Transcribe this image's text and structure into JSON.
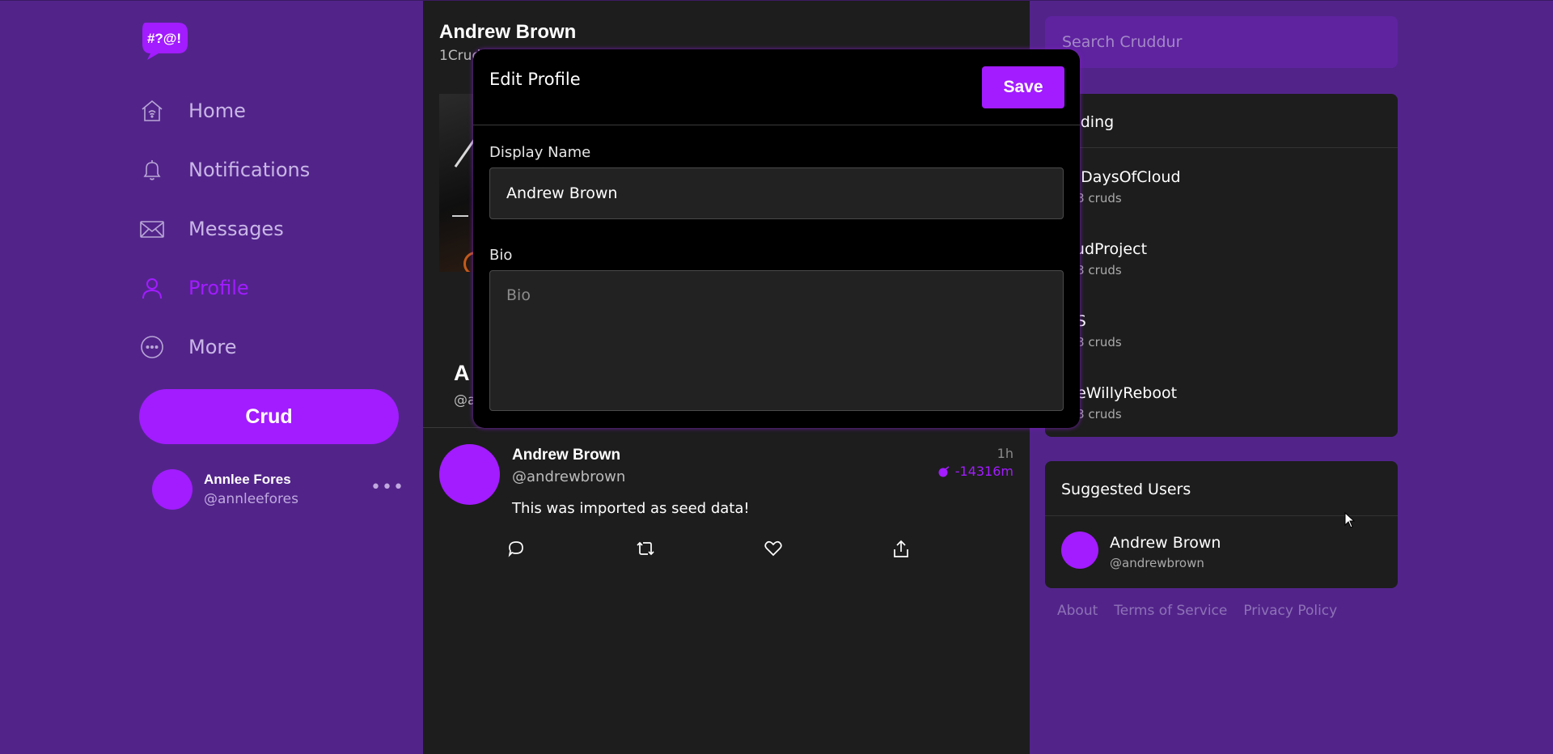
{
  "app": {
    "logo_text": "#?@!"
  },
  "sidebar": {
    "items": [
      {
        "label": "Home",
        "icon": "home-icon",
        "active": false
      },
      {
        "label": "Notifications",
        "icon": "bell-icon",
        "active": false
      },
      {
        "label": "Messages",
        "icon": "mail-icon",
        "active": false
      },
      {
        "label": "Profile",
        "icon": "person-icon",
        "active": true
      },
      {
        "label": "More",
        "icon": "more-circle-icon",
        "active": false
      }
    ],
    "crud_button_label": "Crud",
    "current_user": {
      "name": "Annlee Fores",
      "handle": "@annleefores",
      "menu_icon": "ellipsis-icon"
    }
  },
  "feed": {
    "title": "Andrew Brown",
    "subtitle": "1Crud",
    "profile_name_partial": "A",
    "profile_handle_partial": "@a",
    "posts": [
      {
        "name": "Andrew Brown",
        "handle": "@andrewbrown",
        "time": "1h",
        "expires": "-14316m",
        "text": "This was imported as seed data!",
        "actions": [
          "reply-icon",
          "repost-icon",
          "like-icon",
          "share-icon"
        ]
      }
    ]
  },
  "search": {
    "placeholder": "Search Cruddur",
    "value": ""
  },
  "trending": {
    "header": "ending",
    "items": [
      {
        "name": "00DaysOfCloud",
        "count": "053 cruds"
      },
      {
        "name": "loudProject",
        "count": "253 cruds"
      },
      {
        "name": "WS",
        "count": "053 cruds"
      },
      {
        "name": "reeWillyReboot",
        "count": "753 cruds"
      }
    ]
  },
  "suggested": {
    "header": "Suggested Users",
    "users": [
      {
        "name": "Andrew Brown",
        "handle": "@andrewbrown"
      }
    ]
  },
  "footer": {
    "links": [
      "About",
      "Terms of Service",
      "Privacy Policy"
    ]
  },
  "modal": {
    "title": "Edit Profile",
    "save_label": "Save",
    "display_name_label": "Display Name",
    "display_name_value": "Andrew Brown",
    "bio_label": "Bio",
    "bio_placeholder": "Bio",
    "bio_value": ""
  },
  "colors": {
    "background": "#52248a",
    "panel": "#1d1d1d",
    "accent": "#a21cff",
    "modal": "#000000"
  }
}
